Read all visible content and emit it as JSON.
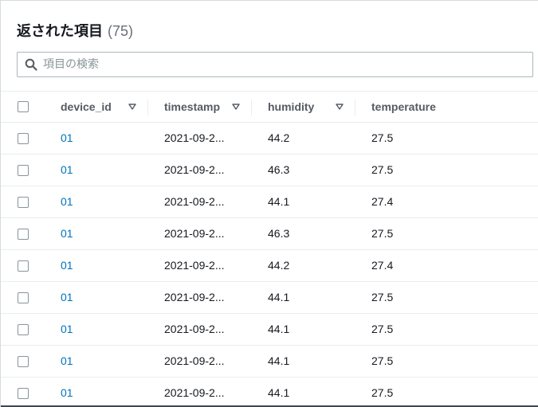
{
  "header": {
    "title": "返された項目",
    "count": "(75)"
  },
  "search": {
    "placeholder": "項目の検索",
    "icon": "search-icon"
  },
  "table": {
    "columns": [
      {
        "label": "device_id",
        "sortable": true
      },
      {
        "label": "timestamp",
        "sortable": true
      },
      {
        "label": "humidity",
        "sortable": true
      },
      {
        "label": "temperature",
        "sortable": false
      }
    ],
    "rows": [
      {
        "device_id": "01",
        "timestamp": "2021-09-2...",
        "humidity": "44.2",
        "temperature": "27.5"
      },
      {
        "device_id": "01",
        "timestamp": "2021-09-2...",
        "humidity": "46.3",
        "temperature": "27.5"
      },
      {
        "device_id": "01",
        "timestamp": "2021-09-2...",
        "humidity": "44.1",
        "temperature": "27.4"
      },
      {
        "device_id": "01",
        "timestamp": "2021-09-2...",
        "humidity": "46.3",
        "temperature": "27.5"
      },
      {
        "device_id": "01",
        "timestamp": "2021-09-2...",
        "humidity": "44.2",
        "temperature": "27.4"
      },
      {
        "device_id": "01",
        "timestamp": "2021-09-2...",
        "humidity": "44.1",
        "temperature": "27.5"
      },
      {
        "device_id": "01",
        "timestamp": "2021-09-2...",
        "humidity": "44.1",
        "temperature": "27.5"
      },
      {
        "device_id": "01",
        "timestamp": "2021-09-2...",
        "humidity": "44.1",
        "temperature": "27.5"
      },
      {
        "device_id": "01",
        "timestamp": "2021-09-2...",
        "humidity": "44.1",
        "temperature": "27.5"
      }
    ]
  },
  "colors": {
    "link": "#0073bb",
    "header_text": "#545b64",
    "border": "#eaeded"
  }
}
